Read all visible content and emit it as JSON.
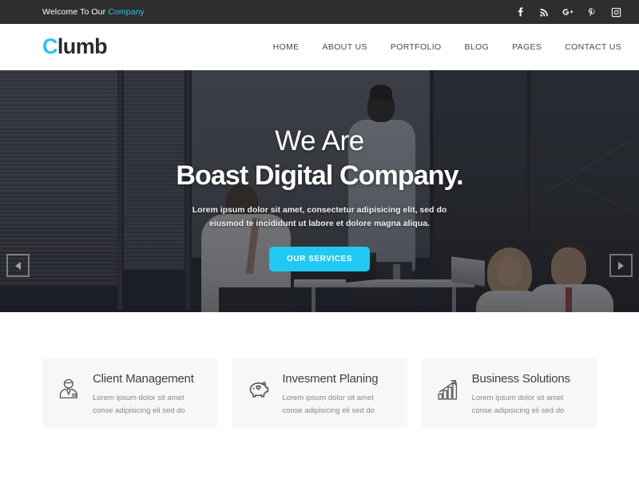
{
  "topbar": {
    "welcome_prefix": "Welcome To Our ",
    "welcome_accent": "Company",
    "accent_color": "#23c6ef",
    "background_color": "#2e2e2e",
    "social": [
      {
        "name": "facebook-icon",
        "label": "f"
      },
      {
        "name": "rss-icon",
        "label": "RSS"
      },
      {
        "name": "google-plus-icon",
        "label": "G+"
      },
      {
        "name": "pinterest-icon",
        "label": "P"
      },
      {
        "name": "instagram-icon",
        "label": "Instagram"
      }
    ]
  },
  "header": {
    "logo_accent": "C",
    "logo_rest": "lumb",
    "nav": [
      {
        "label": "HOME"
      },
      {
        "label": "ABOUT US"
      },
      {
        "label": "PORTFOLIO"
      },
      {
        "label": "BLOG"
      },
      {
        "label": "PAGES"
      },
      {
        "label": "CONTACT US"
      }
    ]
  },
  "hero": {
    "line1": "We Are",
    "line2": "Boast Digital Company.",
    "subtitle": "Lorem ipsum dolor sit amet, consectetur adipisicing elit, sed do eiusmod te incididunt ut labore et dolore magna aliqua.",
    "button_label": "OUR SERVICES",
    "button_color": "#20c9f3",
    "prev_label": "Previous slide",
    "next_label": "Next slide",
    "image_description": "Business team meeting in a bright office with laptops; a man standing presenting to three seated colleagues"
  },
  "services": {
    "cards": [
      {
        "icon": "businessman-icon",
        "title": "Client Management",
        "desc": "Lorem ipsum dolor sit amet conse adipisicing eli sed do"
      },
      {
        "icon": "piggy-bank-heart-icon",
        "title": "Invesment Planing",
        "desc": "Lorem ipsum dolor sit amet conse adipisicing eli sed do"
      },
      {
        "icon": "growth-bar-chart-icon",
        "title": "Business Solutions",
        "desc": "Lorem ipsum dolor sit amet conse adipisicing eli sed do"
      }
    ],
    "card_background": "#f7f7f7"
  }
}
